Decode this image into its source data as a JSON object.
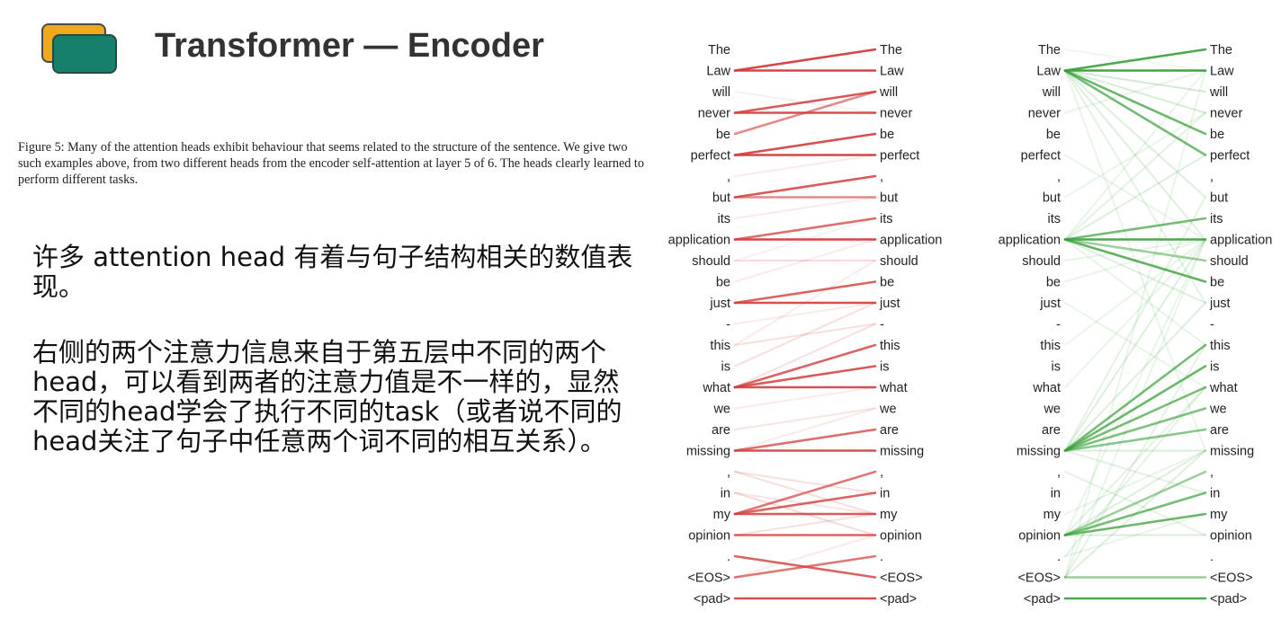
{
  "header": {
    "title": "Transformer — Encoder"
  },
  "caption": "Figure 5: Many of the attention heads exhibit behaviour that seems related to the structure of the sentence. We give two such examples above, from two different heads from the encoder self-attention at layer 5 of 6. The heads clearly learned to perform different tasks.",
  "paragraphs": [
    "许多 attention head 有着与句子结构相关的数值表现。",
    "右侧的两个注意力信息来自于第五层中不同的两个head，可以看到两者的注意力值是不一样的，显然不同的head学会了执行不同的task（或者说不同的head关注了句子中任意两个词不同的相互关系）。"
  ],
  "attention": {
    "tokens": [
      "The",
      "Law",
      "will",
      "never",
      "be",
      "perfect",
      ",",
      "but",
      "its",
      "application",
      "should",
      "be",
      "just",
      "-",
      "this",
      "is",
      "what",
      "we",
      "are",
      "missing",
      ",",
      "in",
      "my",
      "opinion",
      ".",
      "<EOS>",
      "<pad>"
    ],
    "heads": [
      {
        "color": "#d43c3c",
        "strong": [
          [
            1,
            0,
            0.95
          ],
          [
            1,
            1,
            0.95
          ],
          [
            3,
            2,
            0.85
          ],
          [
            3,
            3,
            0.9
          ],
          [
            4,
            2,
            0.6
          ],
          [
            5,
            4,
            0.9
          ],
          [
            5,
            5,
            0.95
          ],
          [
            7,
            6,
            0.85
          ],
          [
            7,
            7,
            0.6
          ],
          [
            9,
            8,
            0.75
          ],
          [
            9,
            9,
            0.95
          ],
          [
            12,
            11,
            0.8
          ],
          [
            12,
            12,
            0.9
          ],
          [
            16,
            14,
            0.8
          ],
          [
            16,
            15,
            0.85
          ],
          [
            16,
            16,
            0.9
          ],
          [
            19,
            18,
            0.75
          ],
          [
            19,
            19,
            0.9
          ],
          [
            22,
            20,
            0.7
          ],
          [
            22,
            21,
            0.8
          ],
          [
            22,
            22,
            0.85
          ],
          [
            23,
            23,
            0.8
          ],
          [
            24,
            25,
            0.8
          ],
          [
            25,
            24,
            0.7
          ],
          [
            26,
            26,
            0.9
          ]
        ],
        "weak": [
          [
            10,
            10,
            0.35
          ],
          [
            11,
            9,
            0.2
          ],
          [
            14,
            13,
            0.3
          ],
          [
            14,
            10,
            0.2
          ],
          [
            15,
            12,
            0.3
          ],
          [
            16,
            13,
            0.3
          ],
          [
            17,
            16,
            0.2
          ],
          [
            18,
            17,
            0.25
          ],
          [
            20,
            21,
            0.3
          ],
          [
            21,
            22,
            0.25
          ],
          [
            21,
            23,
            0.35
          ],
          [
            23,
            22,
            0.3
          ],
          [
            25,
            23,
            0.2
          ],
          [
            8,
            7,
            0.2
          ],
          [
            6,
            5,
            0.2
          ],
          [
            2,
            3,
            0.15
          ],
          [
            13,
            12,
            0.2
          ],
          [
            20,
            22,
            0.3
          ],
          [
            19,
            17,
            0.2
          ],
          [
            10,
            8,
            0.15
          ]
        ]
      },
      {
        "color": "#3aa03a",
        "strong": [
          [
            1,
            0,
            0.9
          ],
          [
            1,
            1,
            0.95
          ],
          [
            1,
            4,
            0.75
          ],
          [
            1,
            5,
            0.7
          ],
          [
            9,
            9,
            0.9
          ],
          [
            9,
            11,
            0.8
          ],
          [
            9,
            8,
            0.7
          ],
          [
            9,
            10,
            0.5
          ],
          [
            19,
            14,
            0.7
          ],
          [
            19,
            15,
            0.75
          ],
          [
            19,
            16,
            0.7
          ],
          [
            19,
            17,
            0.65
          ],
          [
            19,
            18,
            0.6
          ],
          [
            23,
            21,
            0.7
          ],
          [
            23,
            22,
            0.75
          ],
          [
            23,
            20,
            0.5
          ],
          [
            26,
            26,
            0.9
          ],
          [
            25,
            25,
            0.5
          ]
        ],
        "weak": [
          [
            1,
            7,
            0.3
          ],
          [
            1,
            9,
            0.3
          ],
          [
            1,
            12,
            0.25
          ],
          [
            1,
            19,
            0.2
          ],
          [
            1,
            2,
            0.4
          ],
          [
            1,
            3,
            0.35
          ],
          [
            9,
            5,
            0.3
          ],
          [
            9,
            3,
            0.25
          ],
          [
            9,
            1,
            0.2
          ],
          [
            9,
            12,
            0.3
          ],
          [
            9,
            14,
            0.2
          ],
          [
            19,
            9,
            0.3
          ],
          [
            19,
            7,
            0.25
          ],
          [
            19,
            12,
            0.3
          ],
          [
            19,
            19,
            0.35
          ],
          [
            19,
            21,
            0.25
          ],
          [
            23,
            16,
            0.25
          ],
          [
            23,
            19,
            0.3
          ],
          [
            23,
            23,
            0.35
          ],
          [
            23,
            9,
            0.2
          ],
          [
            25,
            19,
            0.3
          ],
          [
            25,
            14,
            0.25
          ],
          [
            25,
            9,
            0.2
          ],
          [
            25,
            1,
            0.2
          ],
          [
            24,
            16,
            0.25
          ],
          [
            24,
            22,
            0.2
          ],
          [
            12,
            16,
            0.2
          ],
          [
            5,
            9,
            0.2
          ],
          [
            3,
            1,
            0.2
          ],
          [
            7,
            3,
            0.2
          ],
          [
            20,
            23,
            0.25
          ],
          [
            22,
            19,
            0.2
          ],
          [
            14,
            9,
            0.2
          ],
          [
            16,
            9,
            0.2
          ],
          [
            0,
            1,
            0.15
          ],
          [
            11,
            9,
            0.2
          ],
          [
            10,
            9,
            0.2
          ]
        ]
      }
    ]
  }
}
